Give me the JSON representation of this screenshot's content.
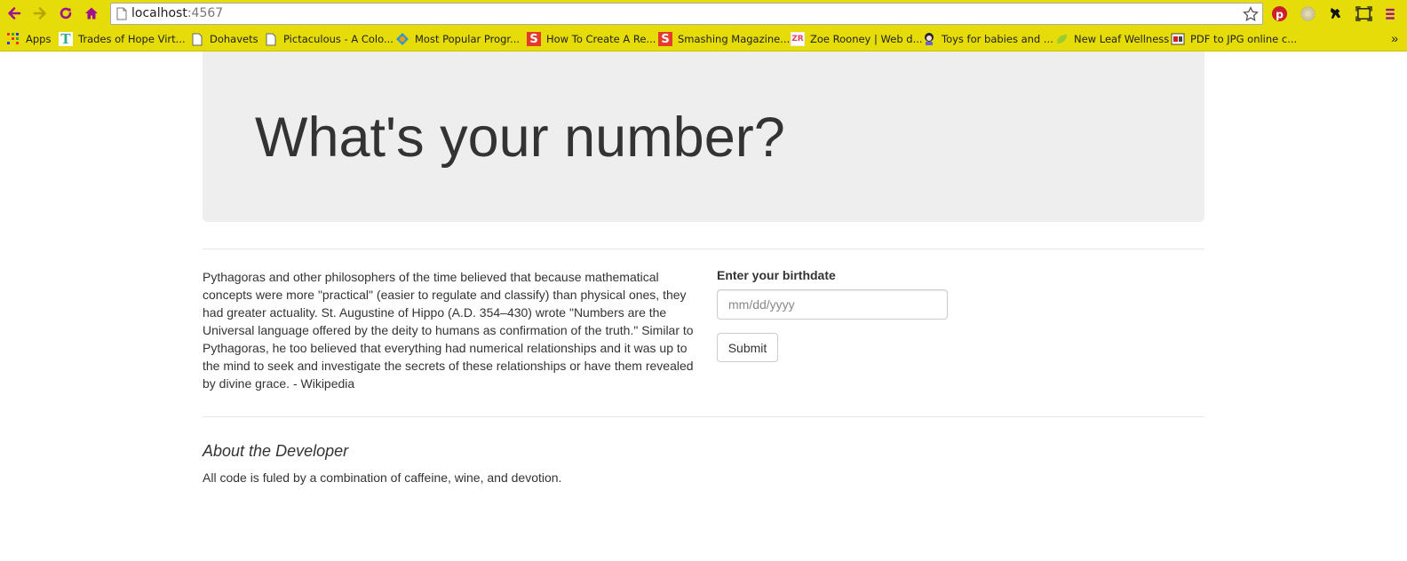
{
  "browser": {
    "url_host": "localhost",
    "url_port": ":4567",
    "accent_color": "#e5dc0a",
    "nav_icons": [
      "back-icon",
      "forward-icon",
      "reload-icon",
      "home-icon"
    ],
    "extension_icons": [
      "pinterest-icon",
      "extension-gray-icon",
      "extension-figure-icon",
      "screen-capture-icon",
      "menu-icon"
    ]
  },
  "bookmarks": [
    {
      "label": "Apps",
      "icon": "apps-grid-icon"
    },
    {
      "label": "Trades of Hope Virt...",
      "icon": "t-letter-icon"
    },
    {
      "label": "Dohavets",
      "icon": "page-icon"
    },
    {
      "label": "Pictaculous - A Colo...",
      "icon": "page-icon"
    },
    {
      "label": "Most Popular Progr...",
      "icon": "colorful-icon"
    },
    {
      "label": "How To Create A Re...",
      "icon": "smashing-icon"
    },
    {
      "label": "Smashing Magazine...",
      "icon": "smashing-icon"
    },
    {
      "label": "Zoe Rooney | Web d...",
      "icon": "zr-icon"
    },
    {
      "label": "Toys for babies and ...",
      "icon": "toy-icon"
    },
    {
      "label": "New Leaf Wellness",
      "icon": "leaf-icon"
    },
    {
      "label": "PDF to JPG online c...",
      "icon": "pdf-icon"
    }
  ],
  "bookmarks_more": "»",
  "jumbotron": {
    "title": "What's your number?"
  },
  "quote": {
    "text": "Pythagoras and other philosophers of the time believed that because mathematical concepts were more \"practical\" (easier to regulate and classify) than physical ones, they had greater actuality. St. Augustine of Hippo (A.D. 354–430) wrote \"Numbers are the Universal language offered by the deity to humans as confirmation of the truth.\" Similar to Pythagoras, he too believed that everything had numerical relationships and it was up to the mind to seek and investigate the secrets of these relationships or have them revealed by divine grace. - Wikipedia"
  },
  "form": {
    "label": "Enter your birthdate",
    "placeholder": "mm/dd/yyyy",
    "submit_label": "Submit"
  },
  "about": {
    "title": "About the Developer",
    "text": "All code is fuled by a combination of caffeine, wine, and devotion."
  }
}
